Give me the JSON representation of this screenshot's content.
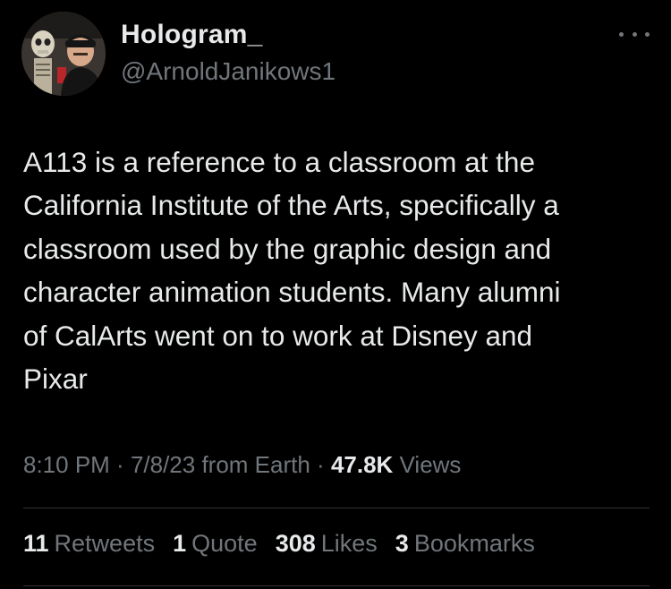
{
  "author": {
    "display_name": "Hologram_",
    "handle": "@ArnoldJanikows1",
    "avatar_icon": "profile-photo"
  },
  "more_icon": "ellipsis-icon",
  "tweet": {
    "text": "A113 is a reference to a classroom at the\nCalifornia Institute of the Arts, specifically a\nclassroom used by the graphic design and\ncharacter animation students. Many alumni\nof CalArts went on to work at Disney and\nPixar"
  },
  "meta": {
    "time": "8:10 PM",
    "sep1": " · ",
    "date": "7/8/23",
    "source": " from Earth",
    "sep2": " · ",
    "views_count": "47.8K",
    "views_label": " Views"
  },
  "stats": {
    "retweets_count": "11",
    "retweets_label": "Retweets",
    "quotes_count": "1",
    "quotes_label": "Quote",
    "likes_count": "308",
    "likes_label": "Likes",
    "bookmarks_count": "3",
    "bookmarks_label": "Bookmarks"
  },
  "colors": {
    "background": "#000000",
    "primary_text": "#e7e9ea",
    "secondary_text": "#71767b",
    "divider": "#2f3336"
  }
}
